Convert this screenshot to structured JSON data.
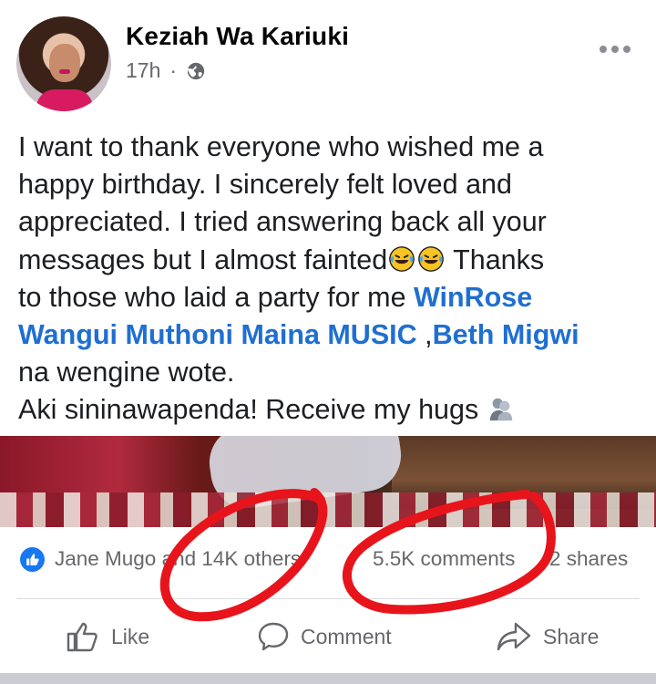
{
  "post": {
    "author": "Keziah Wa Kariuki",
    "time": "17h",
    "separator": "·",
    "text": {
      "line1": "I want to thank everyone who wished me a",
      "line2": "happy birthday. I sincerely felt loved and",
      "line3": "appreciated. I tried answering back all your",
      "line4_a": "messages but I almost fainted",
      "line4_b": " Thanks",
      "line5_a": "to those who laid a party for me ",
      "mention_1": "WinRose",
      "mention_2": "Wangui Muthoni Maina MUSIC",
      "line6_sep": " ,",
      "mention_3": "Beth Migwi",
      "line7": "na wengine wote.",
      "line8": "Aki sininawapenda! Receive my hugs "
    }
  },
  "stats": {
    "reactions": "Jane Mugo and 14K others",
    "comments": "5.5K comments",
    "shares": "2 shares"
  },
  "actions": {
    "like": "Like",
    "comment": "Comment",
    "share": "Share"
  },
  "colors": {
    "mention": "#1f6fd1",
    "like_badge": "#1877f2",
    "annotation_red": "#e8141c"
  },
  "icons": [
    "globe-icon",
    "more-options-icon",
    "laughing-emoji",
    "hug-emoji",
    "like-thumb-icon",
    "comment-icon",
    "share-icon"
  ]
}
